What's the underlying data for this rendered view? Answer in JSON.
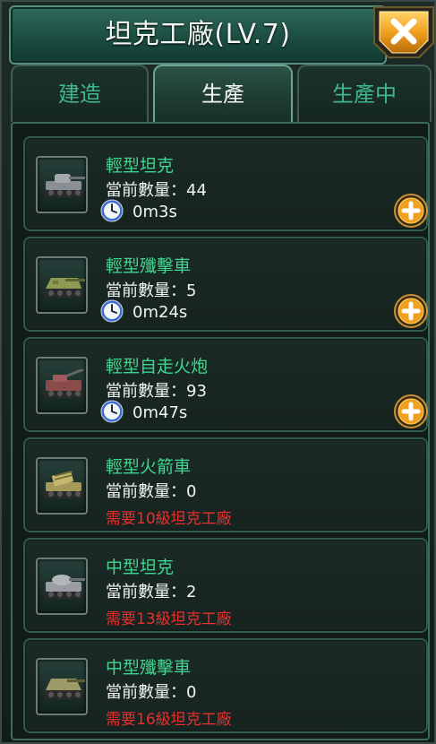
{
  "header": {
    "title": "坦克工廠(LV.7)"
  },
  "tabs": [
    {
      "label": "建造",
      "active": false
    },
    {
      "label": "生產",
      "active": true
    },
    {
      "label": "生產中",
      "active": false
    }
  ],
  "count_label": "當前數量：",
  "units": [
    {
      "name": "輕型坦克",
      "count": "44",
      "time": "0m3s",
      "requirement": null,
      "icon": "light-tank-icon",
      "camo": "#8a8f93"
    },
    {
      "name": "輕型殲擊車",
      "count": "5",
      "time": "0m24s",
      "requirement": null,
      "icon": "tank-destroyer-icon",
      "camo": "#8f9a52"
    },
    {
      "name": "輕型自走火炮",
      "count": "93",
      "time": "0m47s",
      "requirement": null,
      "icon": "self-propelled-gun-icon",
      "camo": "#8a4b4b"
    },
    {
      "name": "輕型火箭車",
      "count": "0",
      "time": null,
      "requirement": "需要10級坦克工廠",
      "icon": "rocket-vehicle-icon",
      "camo": "#a69a5a"
    },
    {
      "name": "中型坦克",
      "count": "2",
      "time": null,
      "requirement": "需要13級坦克工廠",
      "icon": "medium-tank-icon",
      "camo": "#9a9ea2"
    },
    {
      "name": "中型殲擊車",
      "count": "0",
      "time": null,
      "requirement": "需要16級坦克工廠",
      "icon": "medium-tank-destroyer-icon",
      "camo": "#9c9a66"
    }
  ],
  "colors": {
    "unit_name": "#3fd68f",
    "requirement": "#ea2f2f",
    "tab_inactive": "#3fb78a",
    "close_button": "#f0a020"
  }
}
